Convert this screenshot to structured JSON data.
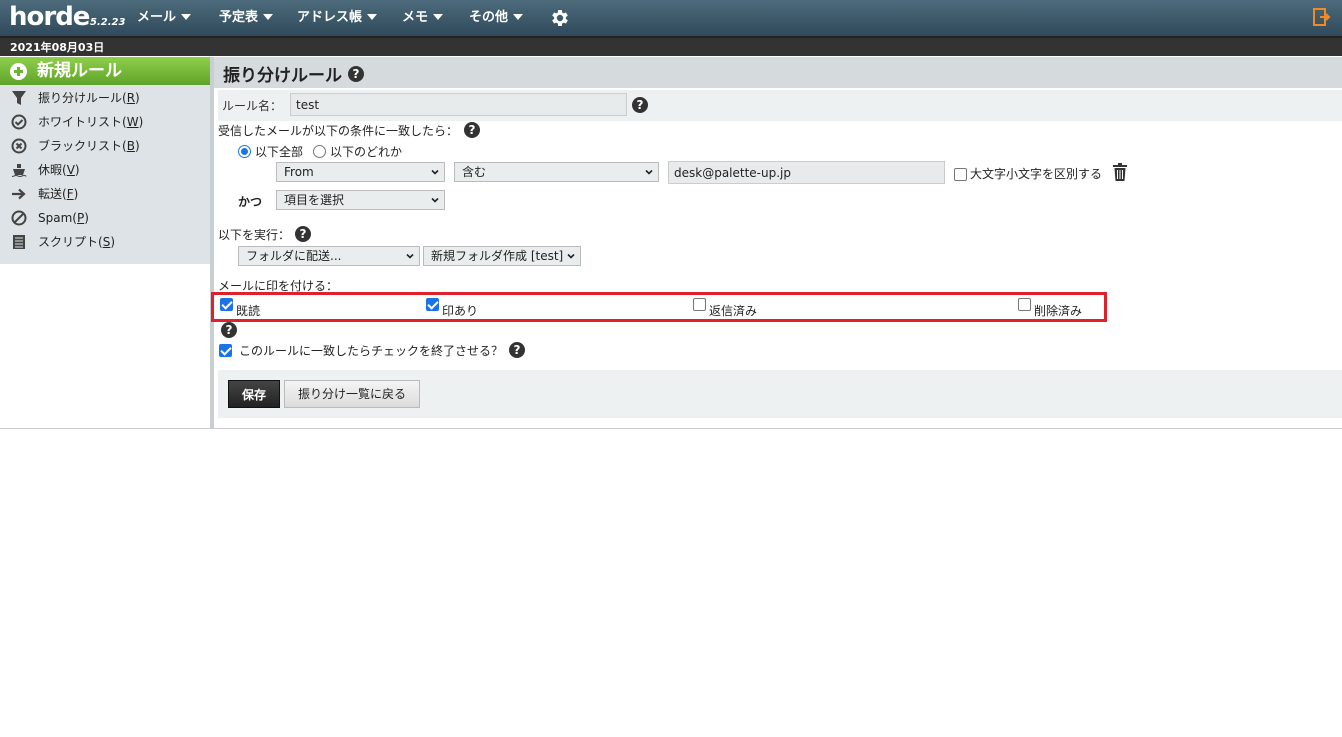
{
  "app": {
    "logo": "horde",
    "version": "5.2.23"
  },
  "topmenu": [
    {
      "label": "メール"
    },
    {
      "label": "予定表"
    },
    {
      "label": "アドレス帳"
    },
    {
      "label": "メモ"
    },
    {
      "label": "その他"
    }
  ],
  "date": "2021年08月03日",
  "sidebar": {
    "new_rule": "新規ルール",
    "items": [
      {
        "label": "振り分けルール",
        "key": "R",
        "icon": "filter-icon"
      },
      {
        "label": "ホワイトリスト",
        "key": "W",
        "icon": "check-circle-icon"
      },
      {
        "label": "ブラックリスト",
        "key": "B",
        "icon": "block-circle-icon"
      },
      {
        "label": "休暇",
        "key": "V",
        "icon": "ship-icon"
      },
      {
        "label": "転送",
        "key": "F",
        "icon": "arrow-right-icon"
      },
      {
        "label": "Spam",
        "key": "P",
        "icon": "no-entry-icon"
      },
      {
        "label": "スクリプト",
        "key": "S",
        "icon": "script-icon"
      }
    ]
  },
  "form": {
    "title": "振り分けルール",
    "help": "?",
    "name_label": "ルール名：",
    "name_value": "test",
    "condition_label": "受信したメールが以下の条件に一致したら：",
    "match_all": "以下全部",
    "match_any": "以下のどれか",
    "field_select": "From",
    "op_select": "含む",
    "value": "desk@palette-up.jp",
    "case_label": "大文字小文字を区別する",
    "and_label": "かつ",
    "and_select": "項目を選択",
    "action_label": "以下を実行：",
    "action_select": "フォルダに配送...",
    "folder_select": "新規フォルダ作成 [test]",
    "flag_label": "メールに印を付ける：",
    "flags": [
      {
        "label": "既読",
        "checked": true
      },
      {
        "label": "印あり",
        "checked": true
      },
      {
        "label": "返信済み",
        "checked": false
      },
      {
        "label": "削除済み",
        "checked": false
      }
    ],
    "stop_label": "このルールに一致したらチェックを終了させる？",
    "save_label": "保存",
    "back_label": "振り分け一覧に戻る"
  }
}
